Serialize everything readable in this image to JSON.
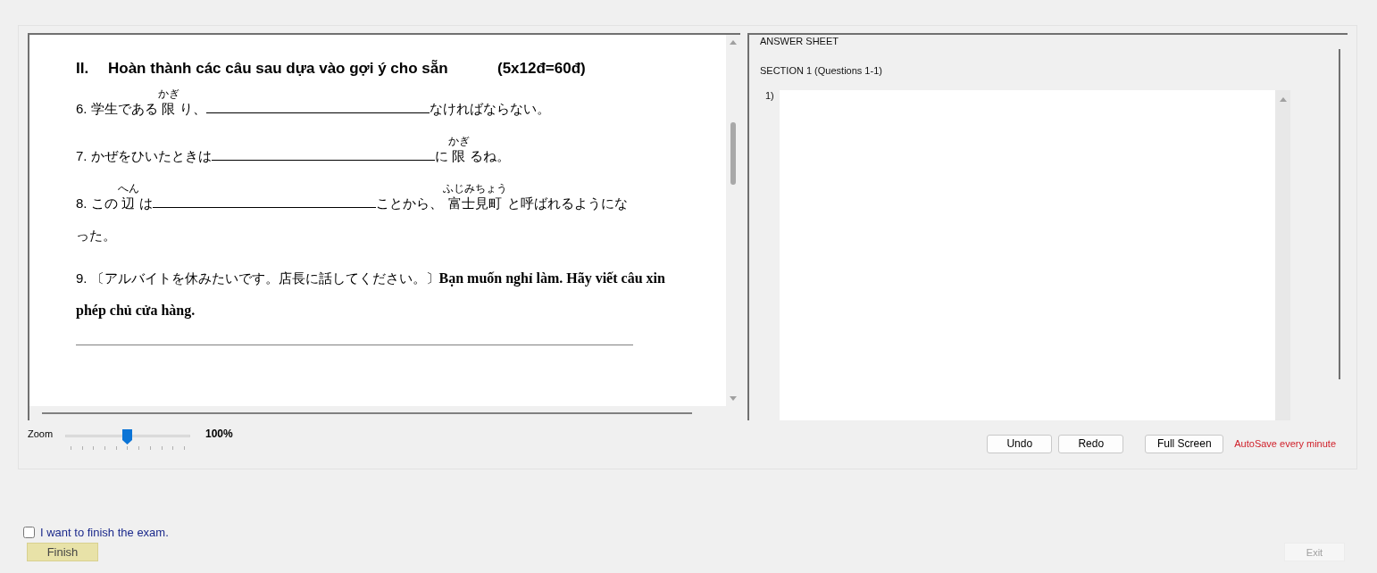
{
  "document": {
    "heading": {
      "number": "II.",
      "title": "Hoàn thành các câu sau dựa vào gợi ý cho sẵn",
      "points": "(5x12đ=60đ)"
    },
    "questions": [
      {
        "number": "6.",
        "answer_line": false,
        "segments": [
          {
            "kind": "text",
            "text": "学生である"
          },
          {
            "kind": "ruby",
            "text": "限",
            "ruby": "かぎ"
          },
          {
            "kind": "text",
            "text": "り、"
          },
          {
            "kind": "blank"
          },
          {
            "kind": "text",
            "text": "なければならない。"
          }
        ]
      },
      {
        "number": "7.",
        "answer_line": false,
        "segments": [
          {
            "kind": "text",
            "text": "かぜをひいたときは"
          },
          {
            "kind": "blank"
          },
          {
            "kind": "text",
            "text": "に"
          },
          {
            "kind": "ruby",
            "text": "限",
            "ruby": "かぎ"
          },
          {
            "kind": "text",
            "text": "るね。"
          }
        ]
      },
      {
        "number": "8.",
        "answer_line": false,
        "segments": [
          {
            "kind": "text",
            "text": "この"
          },
          {
            "kind": "ruby",
            "text": "辺",
            "ruby": "へん"
          },
          {
            "kind": "text",
            "text": "は"
          },
          {
            "kind": "blank"
          },
          {
            "kind": "text",
            "text": "ことから、"
          },
          {
            "kind": "ruby",
            "text": "富士見町",
            "ruby": "ふじみちょう"
          },
          {
            "kind": "text",
            "text": "と呼ばれるようにな"
          },
          {
            "kind": "break"
          },
          {
            "kind": "text",
            "text": "った。"
          }
        ]
      },
      {
        "number": "9.",
        "answer_line": true,
        "segments": [
          {
            "kind": "text",
            "text": "〔アルバイトを休みたいです。店長に話してください。〕"
          },
          {
            "kind": "bold",
            "text": "Bạn muốn nghỉ làm. Hãy viết câu xin"
          },
          {
            "kind": "break"
          },
          {
            "kind": "bold",
            "text": "phép chủ cửa hàng."
          }
        ]
      }
    ]
  },
  "answer_sheet": {
    "title": "ANSWER SHEET",
    "section": "SECTION 1 (Questions 1-1)",
    "answers": [
      {
        "label": "1)"
      }
    ]
  },
  "zoom": {
    "label": "Zoom",
    "level": 0.5,
    "reading": "100%"
  },
  "buttons": [
    {
      "label": "Undo"
    },
    {
      "label": "Redo"
    },
    {
      "label": "Full Screen"
    }
  ],
  "autosave_note": "AutoSave every minute",
  "finish": {
    "checkbox_label": "I want to finish the exam.",
    "checked": false,
    "button": "Finish"
  },
  "exit": {
    "label": "Exit",
    "disabled": true
  }
}
